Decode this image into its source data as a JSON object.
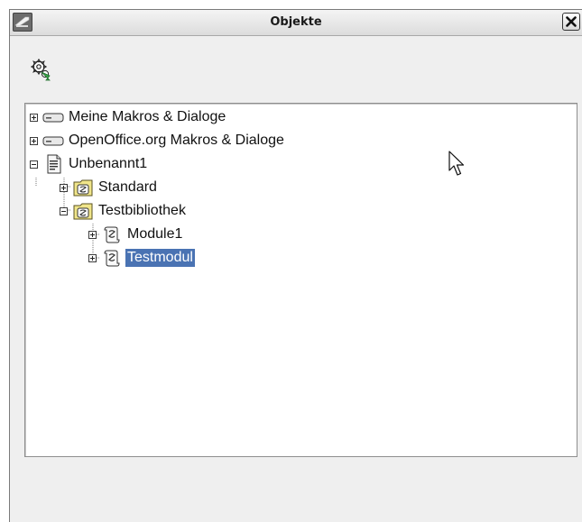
{
  "window": {
    "title": "Objekte"
  },
  "icons": {
    "app": "app-icon",
    "close": "close-icon",
    "organize": "organize-macros-icon",
    "storage": "storage-drive-icon",
    "document": "document-icon",
    "library": "library-icon",
    "module": "module-scroll-icon",
    "pointer": "mouse-pointer-icon"
  },
  "tree": {
    "nodes": [
      {
        "label": "Meine Makros & Dialoge",
        "expanded": false
      },
      {
        "label": "OpenOffice.org Makros & Dialoge",
        "expanded": false
      },
      {
        "label": "Unbenannt1",
        "expanded": true
      },
      {
        "label": "Standard",
        "expanded": false
      },
      {
        "label": "Testbibliothek",
        "expanded": true
      },
      {
        "label": "Module1",
        "expanded": false
      },
      {
        "label": "Testmodul",
        "expanded": false,
        "selected": true
      }
    ]
  },
  "colors": {
    "selection": "#4a73b3",
    "library_folder": "#f0e58a"
  }
}
